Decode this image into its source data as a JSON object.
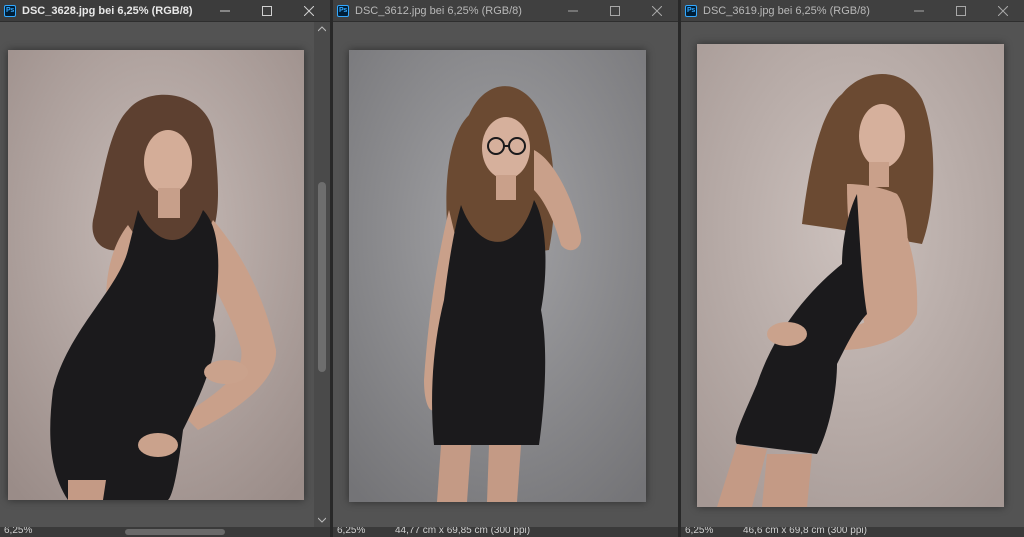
{
  "windows": [
    {
      "title": "DSC_3628.jpg bei 6,25% (RGB/8)",
      "zoom": "6,25%",
      "dimensions": "",
      "active": true,
      "pose": "hand-on-hip"
    },
    {
      "title": "DSC_3612.jpg bei 6,25% (RGB/8)",
      "zoom": "6,25%",
      "dimensions": "44,77 cm x 69,85 cm (300 ppi)",
      "active": false,
      "pose": "hand-in-hair-glasses"
    },
    {
      "title": "DSC_3619.jpg bei 6,25% (RGB/8)",
      "zoom": "6,25%",
      "dimensions": "46,6 cm x 69,8 cm (300 ppi)",
      "active": false,
      "pose": "side-turn-hands-on-hip"
    }
  ],
  "app_icon_label": "Ps",
  "icons": {
    "minimize": "minimize-icon",
    "maximize": "maximize-icon",
    "close": "close-icon"
  },
  "colors": {
    "backdrop_warm": "#b7a9a4",
    "backdrop_cool": "#8e8e90",
    "dress": "#1b1a1c",
    "skin": "#c9a08a",
    "hair": "#6b4a32"
  }
}
